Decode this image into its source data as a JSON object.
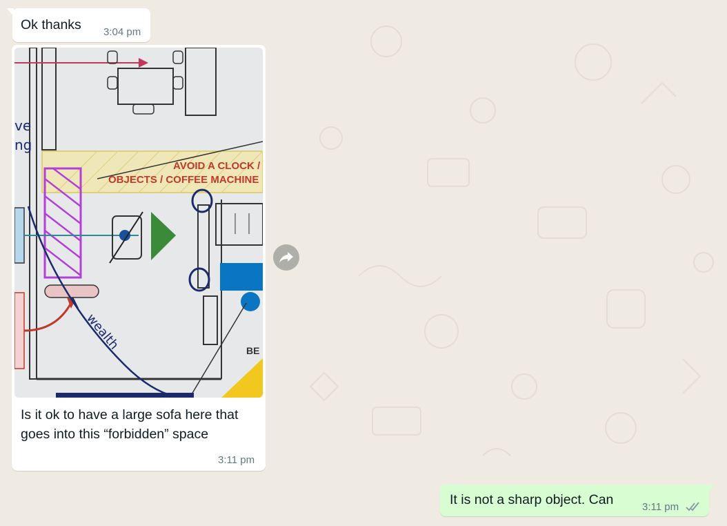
{
  "messages": [
    {
      "direction": "incoming",
      "text": "Ok thanks",
      "time": "3:04 pm"
    },
    {
      "direction": "incoming",
      "type": "image",
      "image_labels": [
        "AVOID A CLOCK /",
        "OBJECTS / COFFEE MACHINE",
        "BE",
        "ve",
        "ng",
        "wealth"
      ],
      "caption_lines": [
        "Is it ok to have a large sofa here that",
        "goes into this “forbidden” space"
      ],
      "time": "3:11 pm"
    },
    {
      "direction": "outgoing",
      "text": "It is not a sharp object. Can",
      "time": "3:11 pm",
      "status": "read-double-check-icon"
    }
  ],
  "colors": {
    "background": "#efeae2",
    "incoming_bubble": "#ffffff",
    "outgoing_bubble": "#d9fdd3",
    "timestamp": "#667781",
    "read_ticks": "#8696a0"
  },
  "icons": {
    "forward": "forward-arrow-icon",
    "read_status": "double-check-icon"
  }
}
